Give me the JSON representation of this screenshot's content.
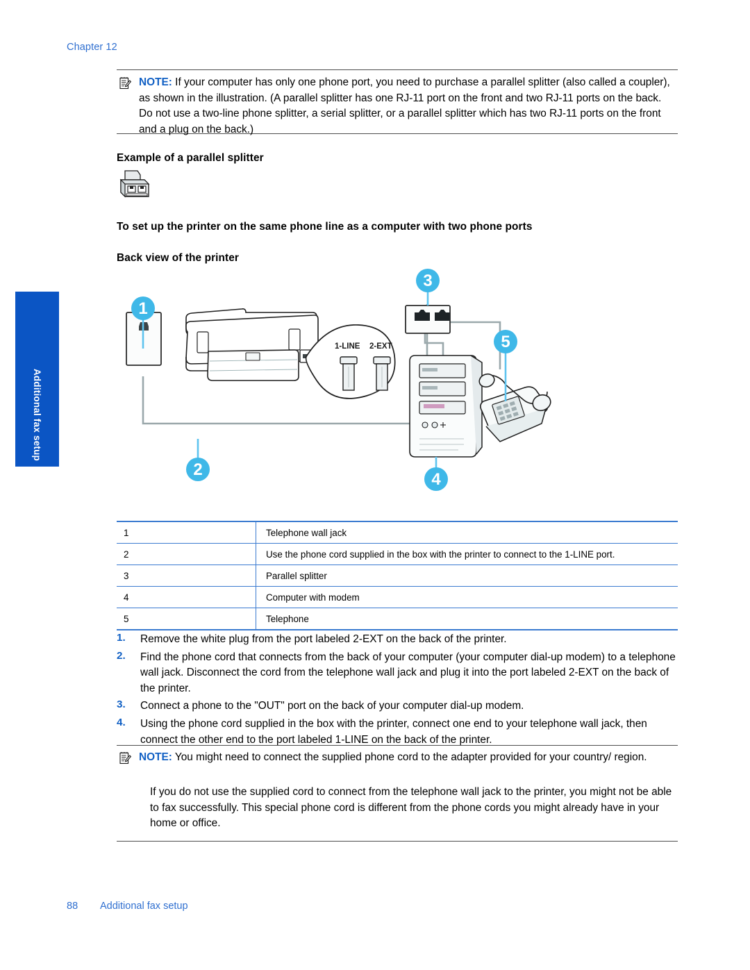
{
  "header": {
    "chapter": "Chapter 12"
  },
  "side_tab": {
    "label": "Additional fax setup",
    "color": "#0b55c4"
  },
  "note_top": {
    "icon": "note-pad-pencil-icon",
    "label": "NOTE:",
    "text": "If your computer has only one phone port, you need to purchase a parallel splitter (also called a coupler), as shown in the illustration. (A parallel splitter has one RJ-11 port on the front and two RJ-11 ports on the back. Do not use a two-line phone splitter, a serial splitter, or a parallel splitter which has two RJ-11 ports on the front and a plug on the back.)"
  },
  "headings": {
    "example_splitter": "Example of a parallel splitter",
    "setup_procedure": "To set up the printer on the same phone line as a computer with two phone ports",
    "back_view": "Back view of the printer"
  },
  "diagram": {
    "port_labels": {
      "line": "1-LINE",
      "ext": "2-EXT"
    },
    "callouts": [
      {
        "number": "1",
        "target": "telephone-wall-jack"
      },
      {
        "number": "2",
        "target": "phone-cord-to-1-line-port"
      },
      {
        "number": "3",
        "target": "parallel-splitter"
      },
      {
        "number": "4",
        "target": "computer-with-modem"
      },
      {
        "number": "5",
        "target": "telephone"
      }
    ],
    "callout_color": "#3fb8e8"
  },
  "legend_table": {
    "rows": [
      {
        "num": "1",
        "desc": "Telephone wall jack"
      },
      {
        "num": "2",
        "desc": "Use the phone cord supplied in the box with the printer to connect to the 1-LINE port."
      },
      {
        "num": "3",
        "desc": "Parallel splitter"
      },
      {
        "num": "4",
        "desc": "Computer with modem"
      },
      {
        "num": "5",
        "desc": "Telephone"
      }
    ],
    "border_color": "#3a7ad0"
  },
  "steps": [
    {
      "num": "1.",
      "text": "Remove the white plug from the port labeled 2-EXT on the back of the printer."
    },
    {
      "num": "2.",
      "text": "Find the phone cord that connects from the back of your computer (your computer dial-up modem) to a telephone wall jack. Disconnect the cord from the telephone wall jack and plug it into the port labeled 2-EXT on the back of the printer."
    },
    {
      "num": "3.",
      "text": "Connect a phone to the \"OUT\" port on the back of your computer dial-up modem."
    },
    {
      "num": "4.",
      "text": "Using the phone cord supplied in the box with the printer, connect one end to your telephone wall jack, then connect the other end to the port labeled 1-LINE on the back of the printer."
    }
  ],
  "note_bottom": {
    "icon": "note-pad-pencil-icon",
    "label": "NOTE:",
    "text": "You might need to connect the supplied phone cord to the adapter provided for your country/ region."
  },
  "closing_paragraph": "If you do not use the supplied cord to connect from the telephone wall jack to the printer, you might not be able to fax successfully. This special phone cord is different from the phone cords you might already have in your home or office.",
  "footer": {
    "page_number": "88",
    "section": "Additional fax setup"
  }
}
